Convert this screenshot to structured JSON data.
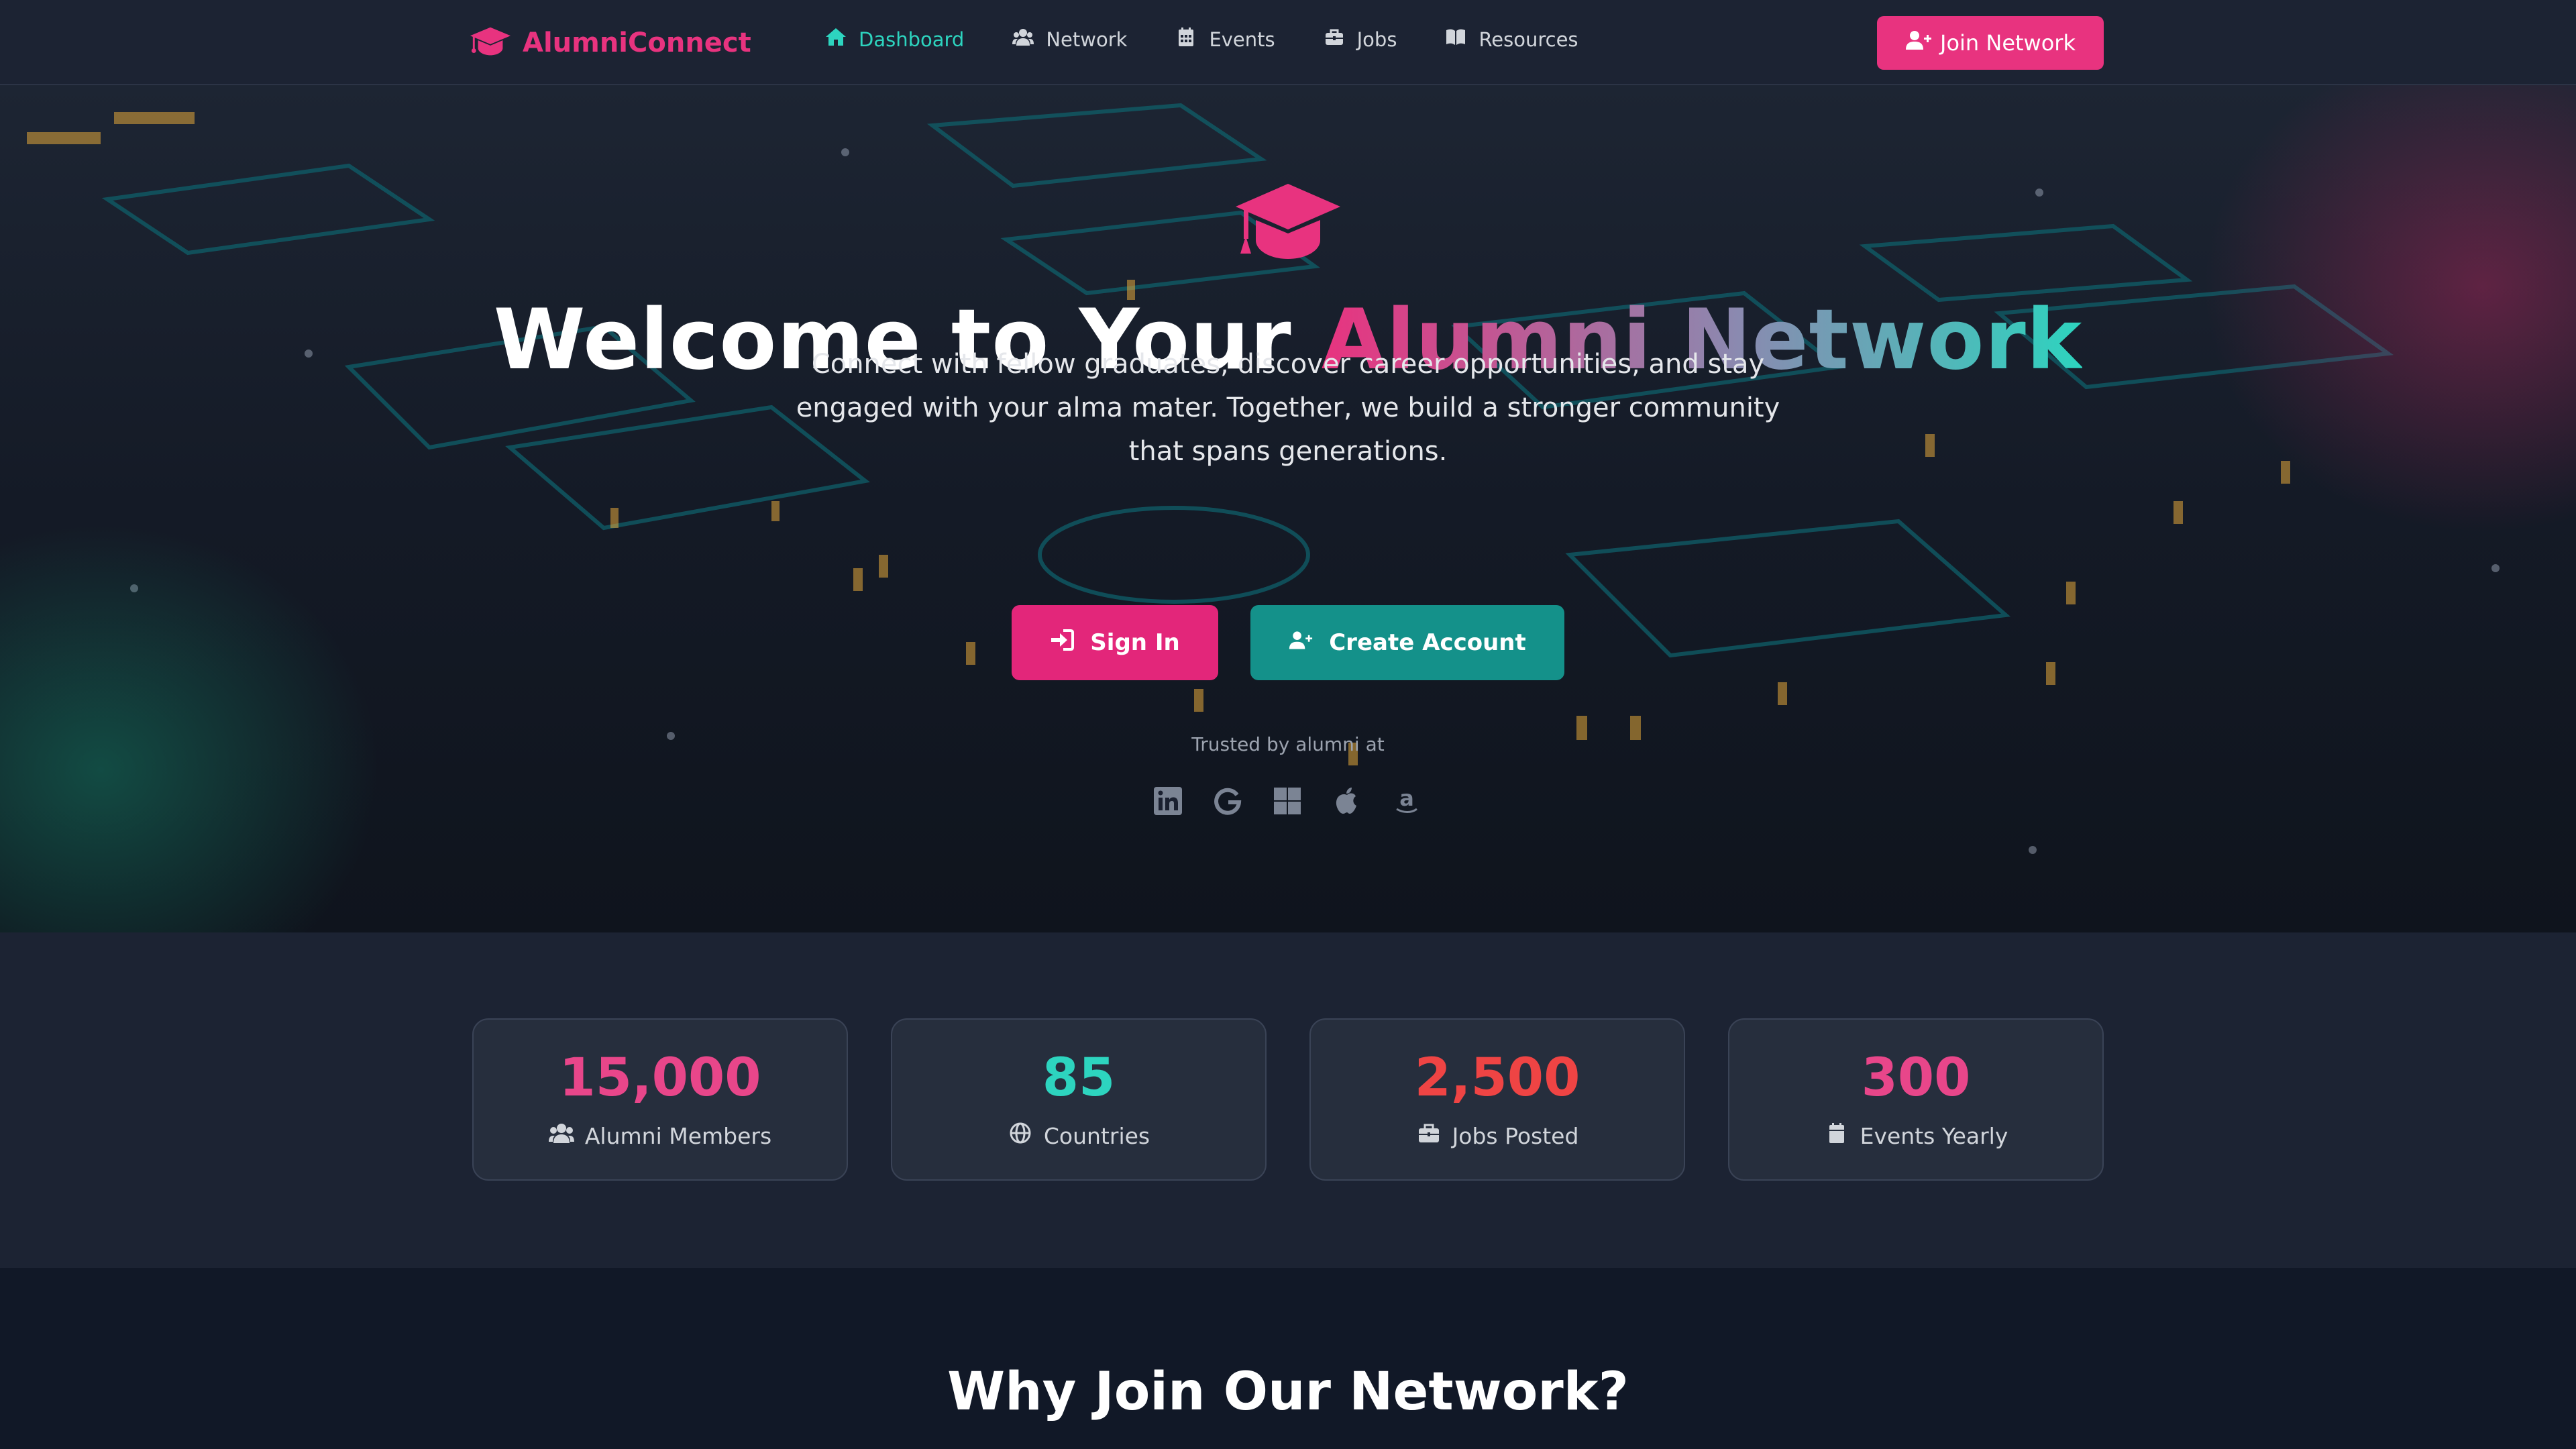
{
  "nav": {
    "brand": "AlumniConnect",
    "links": [
      {
        "label": "Dashboard",
        "icon": "home-icon",
        "active": true
      },
      {
        "label": "Network",
        "icon": "users-icon",
        "active": false
      },
      {
        "label": "Events",
        "icon": "calendar-icon",
        "active": false
      },
      {
        "label": "Jobs",
        "icon": "briefcase-icon",
        "active": false
      },
      {
        "label": "Resources",
        "icon": "book-icon",
        "active": false
      }
    ],
    "join_label": "Join Network"
  },
  "hero": {
    "title_plain": "Welcome to Your ",
    "title_highlight": "Alumni Network",
    "subtitle": "Connect with fellow graduates, discover career opportunities, and stay engaged with your alma mater. Together, we build a stronger community that spans generations.",
    "signin_label": "Sign In",
    "create_label": "Create Account",
    "trusted_label": "Trusted by alumni at",
    "trusted_logos": [
      "linkedin-icon",
      "google-icon",
      "windows-icon",
      "apple-icon",
      "amazon-icon"
    ]
  },
  "stats": [
    {
      "value": "15,000",
      "label": "Alumni Members",
      "icon": "users-icon",
      "color": "#e8468a"
    },
    {
      "value": "85",
      "label": "Countries",
      "icon": "globe-icon",
      "color": "#2dd4bf"
    },
    {
      "value": "2,500",
      "label": "Jobs Posted",
      "icon": "briefcase-icon",
      "color": "#ef4444"
    },
    {
      "value": "300",
      "label": "Events Yearly",
      "icon": "calendar-icon",
      "color": "#e8468a"
    }
  ],
  "why": {
    "title": "Why Join Our Network?"
  },
  "colors": {
    "accent_pink": "#e8337f",
    "accent_teal": "#2dd4bf",
    "background": "#111827"
  }
}
